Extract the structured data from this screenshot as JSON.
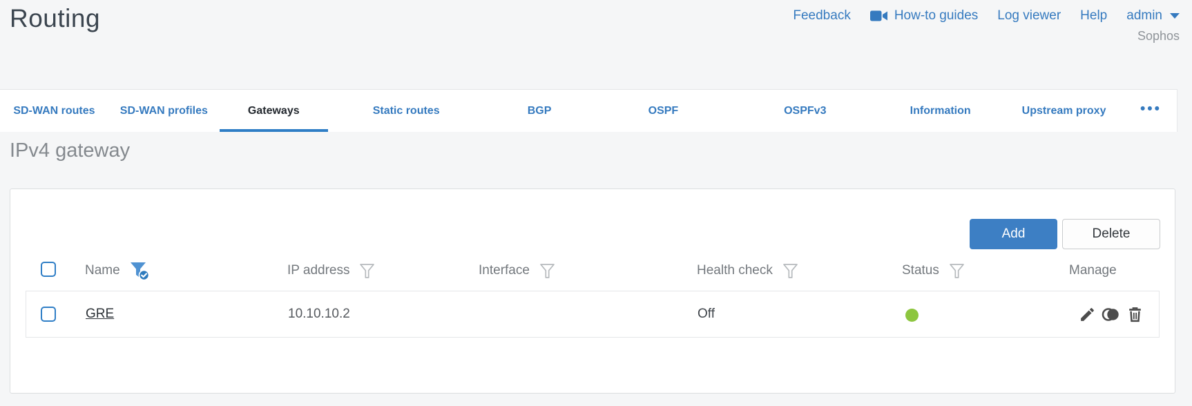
{
  "header": {
    "title": "Routing",
    "links": {
      "feedback": "Feedback",
      "howto": "How-to guides",
      "log_viewer": "Log viewer",
      "help": "Help",
      "user": "admin",
      "brand": "Sophos"
    }
  },
  "tabs": {
    "items": [
      {
        "label": "SD-WAN routes",
        "active": false
      },
      {
        "label": "SD-WAN profiles",
        "active": false
      },
      {
        "label": "Gateways",
        "active": true
      },
      {
        "label": "Static routes",
        "active": false
      },
      {
        "label": "BGP",
        "active": false
      },
      {
        "label": "OSPF",
        "active": false
      },
      {
        "label": "OSPFv3",
        "active": false
      },
      {
        "label": "Information",
        "active": false
      },
      {
        "label": "Upstream proxy",
        "active": false
      }
    ],
    "more_glyph": "•••"
  },
  "section": {
    "heading": "IPv4 gateway"
  },
  "toolbar": {
    "add_label": "Add",
    "delete_label": "Delete"
  },
  "table": {
    "columns": [
      {
        "label": "Name",
        "filter": true,
        "filter_state": "active"
      },
      {
        "label": "IP address",
        "filter": true,
        "filter_state": "default"
      },
      {
        "label": "Interface",
        "filter": true,
        "filter_state": "default"
      },
      {
        "label": "Health check",
        "filter": true,
        "filter_state": "default"
      },
      {
        "label": "Status",
        "filter": true,
        "filter_state": "default"
      },
      {
        "label": "Manage",
        "filter": false
      }
    ],
    "rows": [
      {
        "name": "GRE",
        "ip_address": "10.10.10.2",
        "interface": "",
        "health_check": "Off",
        "status": "green",
        "status_color": "#8dc63f",
        "manage_icons": [
          "edit",
          "clone",
          "delete"
        ]
      }
    ]
  },
  "colors": {
    "accent_blue": "#357abf",
    "button_blue": "#3d7fc4",
    "status_green": "#8dc63f",
    "active_tab_text": "#23282e"
  }
}
